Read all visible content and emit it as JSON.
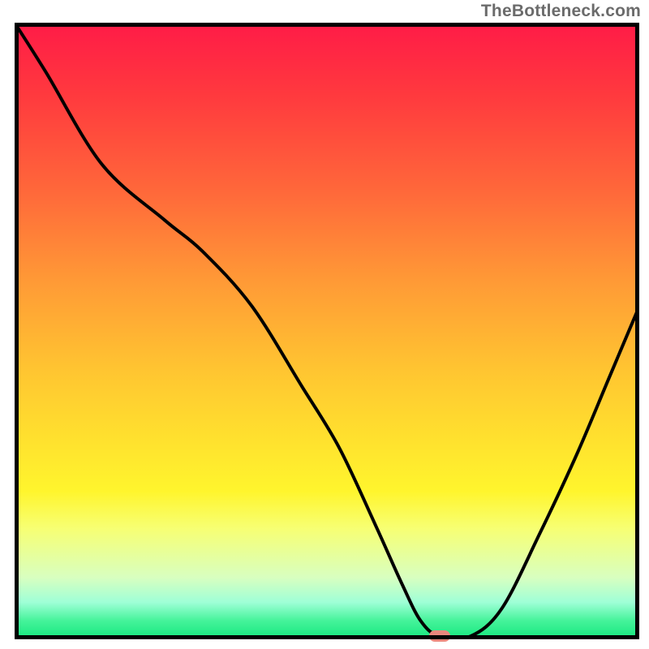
{
  "watermark": "TheBottleneck.com",
  "colors": {
    "frame": "#000000",
    "curve": "#000000",
    "marker": "#e9877d",
    "gradient_top": "#ff1b47",
    "gradient_bottom": "#14e77e"
  },
  "chart_data": {
    "type": "line",
    "title": "",
    "xlabel": "",
    "ylabel": "",
    "xlim": [
      0,
      100
    ],
    "ylim": [
      0,
      100
    ],
    "grid": false,
    "series": [
      {
        "name": "bottleneck-curve",
        "x": [
          0,
          5,
          14,
          24,
          30,
          38,
          46,
          52,
          58,
          62,
          65,
          68,
          73,
          78,
          84,
          90,
          95,
          100
        ],
        "values": [
          100,
          92,
          77,
          68,
          63,
          54,
          41,
          31,
          18,
          9,
          3,
          0.5,
          0.5,
          5,
          17,
          30,
          42,
          54
        ]
      }
    ],
    "annotations": [
      {
        "name": "min-marker",
        "x": 68,
        "y": 0.5
      }
    ]
  }
}
